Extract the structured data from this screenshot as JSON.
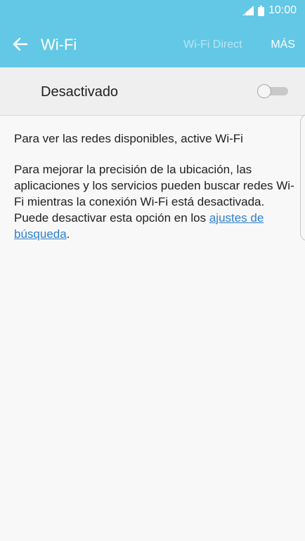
{
  "status_bar": {
    "time": "10:00",
    "signal_icon": "signal-icon",
    "battery_icon": "battery-icon"
  },
  "app_bar": {
    "back_icon": "back-arrow-icon",
    "title": "Wi-Fi",
    "wifi_direct_label": "Wi-Fi Direct",
    "more_label": "MÁS"
  },
  "toggle": {
    "label": "Desactivado",
    "state": "off"
  },
  "content": {
    "paragraph1": "Para ver las redes disponibles, active Wi-Fi",
    "paragraph2_text": "Para mejorar la precisión de la ubicación, las aplicaciones y los servicios pueden buscar redes Wi-Fi mientras la conexión Wi-Fi está desactivada. Puede desactivar esta opción en los ",
    "paragraph2_link": "ajustes de búsqueda",
    "paragraph2_end": "."
  },
  "colors": {
    "header": "#63c7e6",
    "link": "#2e7fcf",
    "background": "#f8f8f8"
  }
}
